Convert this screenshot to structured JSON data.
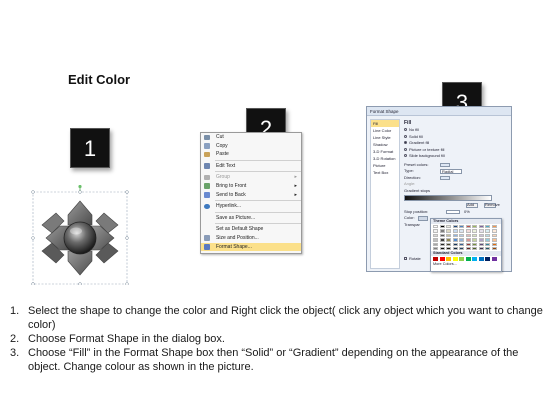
{
  "title": "Edit Color",
  "badges": [
    "1",
    "2",
    "3"
  ],
  "context_menu": {
    "items": [
      {
        "label": "Cut",
        "icon": "scissors-icon",
        "color": "#7a8fa8"
      },
      {
        "label": "Copy",
        "icon": "copy-icon",
        "color": "#8aa0c0"
      },
      {
        "label": "Paste",
        "icon": "clipboard-icon",
        "color": "#c9a25a"
      },
      {
        "label": "Edit Text",
        "icon": "edit-text-icon",
        "color": "#6e86b0"
      },
      {
        "label": "Group",
        "icon": "group-icon",
        "color": "#b0b0b0",
        "disabled": true,
        "submenu": true
      },
      {
        "label": "Bring to Front",
        "icon": "bring-front-icon",
        "color": "#6aa36a",
        "submenu": true
      },
      {
        "label": "Send to Back",
        "icon": "send-back-icon",
        "color": "#6a8ad0",
        "submenu": true
      },
      {
        "label": "Hyperlink...",
        "icon": "globe-icon",
        "color": "#3f7ac0"
      },
      {
        "label": "Save as Picture...",
        "icon": "",
        "color": ""
      },
      {
        "label": "Set as Default Shape",
        "icon": "",
        "color": ""
      },
      {
        "label": "Size and Position...",
        "icon": "size-icon",
        "color": "#8a9cb8"
      },
      {
        "label": "Format Shape...",
        "icon": "format-shape-icon",
        "color": "#5a7ac0",
        "selected": true
      }
    ]
  },
  "format_dialog": {
    "title": "Format Shape",
    "nav": [
      "Fill",
      "Line Color",
      "Line Style",
      "Shadow",
      "3-D Format",
      "3-D Rotation",
      "Picture",
      "Text Box"
    ],
    "section": "Fill",
    "options": [
      "No fill",
      "Solid fill",
      "Gradient fill",
      "Picture or texture fill",
      "Slide background fill"
    ],
    "selected_option": "Gradient fill",
    "preset_label": "Preset colors:",
    "type_label": "Type:",
    "type_value": "Radial",
    "direction_label": "Direction:",
    "angle_label": "Angle:",
    "gradient_stops_label": "Gradient stops",
    "add_label": "Add",
    "remove_label": "Remove",
    "stop_position_label": "Stop position:",
    "stop_position_value": "0%",
    "color_label": "Color:",
    "transparency_label": "Transpar",
    "rotate_label": "Rotate"
  },
  "palette": {
    "theme_label": "Theme Colors",
    "standard_label": "Standard Colors",
    "more_label": "More Colors...",
    "theme_colors": [
      [
        "#ffffff",
        "#000000",
        "#eeece1",
        "#1f497d",
        "#4f81bd",
        "#c0504d",
        "#9bbb59",
        "#8064a2",
        "#4bacc6",
        "#f79646"
      ],
      [
        "#f2f2f2",
        "#7f7f7f",
        "#ddd9c3",
        "#c6d9f0",
        "#dbe5f1",
        "#f2dcdb",
        "#ebf1dd",
        "#e5e0ec",
        "#dbeef3",
        "#fdeada"
      ],
      [
        "#d8d8d8",
        "#595959",
        "#c4bd97",
        "#8db3e2",
        "#b8cce4",
        "#e5b9b7",
        "#d7e3bc",
        "#ccc1d9",
        "#b7dde8",
        "#fbd5b5"
      ],
      [
        "#bfbfbf",
        "#3f3f3f",
        "#938953",
        "#548dd4",
        "#95b3d7",
        "#d99694",
        "#c3d69b",
        "#b2a2c7",
        "#92cddc",
        "#fac08f"
      ],
      [
        "#a5a5a5",
        "#262626",
        "#494429",
        "#17365d",
        "#366092",
        "#953734",
        "#76923c",
        "#5f497a",
        "#31859b",
        "#e36c09"
      ],
      [
        "#7f7f7f",
        "#0c0c0c",
        "#1d1b10",
        "#0f243e",
        "#244061",
        "#632423",
        "#4f6128",
        "#3f3151",
        "#205867",
        "#974806"
      ]
    ],
    "standard_colors": [
      "#c00000",
      "#ff0000",
      "#ffc000",
      "#ffff00",
      "#92d050",
      "#00b050",
      "#00b0f0",
      "#0070c0",
      "#002060",
      "#7030a0"
    ]
  },
  "instructions": [
    {
      "num": "1.",
      "text": "Select the shape to change the color and Right click the object( click any object which you want to change color)"
    },
    {
      "num": "2.",
      "text": "Choose Format Shape in the dialog box."
    },
    {
      "num": "3.",
      "text": "Choose “Fill” in the Format Shape box then “Solid” or “Gradient” depending on the appearance of the object. Change colour as shown in the picture."
    }
  ]
}
